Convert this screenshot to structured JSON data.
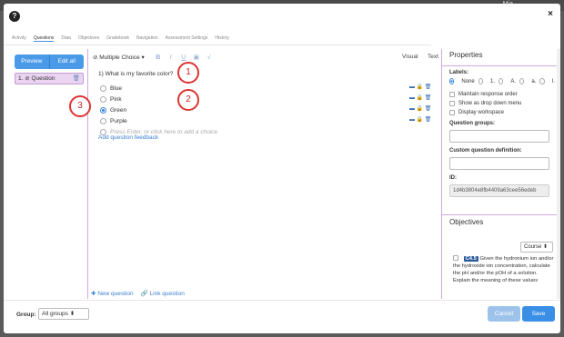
{
  "backdrop": {
    "user_label": "Mia"
  },
  "modal": {
    "help_icon": "question-circle-icon",
    "close_icon": "close-icon",
    "close_glyph": "×",
    "help_glyph": "?"
  },
  "tabs": [
    {
      "label": "Activity"
    },
    {
      "label": "Questions"
    },
    {
      "label": "Data"
    },
    {
      "label": "Objectives"
    },
    {
      "label": "Gradebook"
    },
    {
      "label": "Navigation"
    },
    {
      "label": "Assessment Settings"
    },
    {
      "label": "History"
    }
  ],
  "left_panel": {
    "preview_label": "Preview",
    "edit_all_label": "Edit all",
    "question_item_label": "1. ⊘ Question",
    "trash_glyph": "🗑"
  },
  "editor": {
    "question_type": "⊘ Multiple Choice ▾",
    "fmt_bold": "B",
    "fmt_italic": "I",
    "fmt_underline": "U",
    "fmt_image": "▣",
    "fmt_special": "√",
    "visual_label": "Visual",
    "text_label": "Text",
    "question_text": "1) What is my favorite color?",
    "choices": [
      {
        "label": "Blue",
        "checked": false
      },
      {
        "label": "Pink",
        "checked": false
      },
      {
        "label": "Green",
        "checked": true
      },
      {
        "label": "Purple",
        "checked": false
      }
    ],
    "add_choice_placeholder": "Press Enter, or click here to add a choice",
    "feedback_link": "Add question feedback",
    "new_question": "✚ New question",
    "link_question": "🔗 Link question",
    "row_icons": "▬ 🔒 🗑"
  },
  "callouts": [
    "1",
    "2",
    "3"
  ],
  "properties": {
    "title": "Properties",
    "labels_title": "Labels:",
    "label_options": [
      "None",
      "1.",
      "A.",
      "a.",
      "I."
    ],
    "maintain_order": "Maintain response order",
    "dropdown_menu": "Show as drop down menu",
    "display_workspace": "Display workspace",
    "question_groups_label": "Question groups:",
    "custom_def_label": "Custom question definition:",
    "id_label": "ID:",
    "id_value": "1d4b3804e8fb4409a63cee56edeb"
  },
  "objectives": {
    "title": "Objectives",
    "course_select": "Course ⬍",
    "badge": "C4.5",
    "text": "Given the hydronium ion and/or the hydroxide ion concentration, calculate the pH and/or the pOH of a solution. Explain the meaning of these values"
  },
  "footer": {
    "group_label": "Group:",
    "group_value": "All groups ⬍",
    "cancel_label": "Cancel",
    "save_label": "Save"
  }
}
